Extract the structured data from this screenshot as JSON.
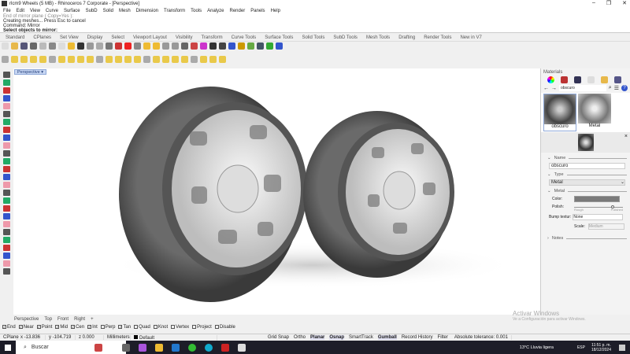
{
  "title": "rlcm9 Wheels (5 MB) - Rhinoceros 7 Corporate - [Perspective]",
  "window_buttons": [
    "–",
    "❐",
    "✕"
  ],
  "menu": [
    "File",
    "Edit",
    "View",
    "Curve",
    "Surface",
    "SubD",
    "Solid",
    "Mesh",
    "Dimension",
    "Transform",
    "Tools",
    "Analyze",
    "Render",
    "Panels",
    "Help"
  ],
  "command_history": [
    "End of mirror plane ( Copy=Yes ):",
    "Creating meshes... Press Esc to cancel",
    "Command: Mirror"
  ],
  "command_prompt": "Select objects to mirror:",
  "toolbar_tabs": [
    "Standard",
    "CPlanes",
    "Set View",
    "Display",
    "Select",
    "Viewport Layout",
    "Visibility",
    "Transform",
    "Curve Tools",
    "Surface Tools",
    "Solid Tools",
    "SubD Tools",
    "Mesh Tools",
    "Drafting",
    "Render Tools",
    "New in V7"
  ],
  "viewport_label": "Perspective ▾",
  "viewport_tabs": [
    "Perspective",
    "Top",
    "Front",
    "Right",
    "+"
  ],
  "materials": {
    "title": "Materials",
    "search": "obscuro",
    "thumbs": [
      "obscuro",
      "Metal"
    ],
    "name_section": "Name",
    "name_value": "obscuro",
    "type_section": "Type",
    "type_value": "Metal",
    "metal_section": "Metal",
    "color_label": "Color:",
    "color": "#7a7a7a",
    "polish_label": "Polish:",
    "polish_min": "Rough",
    "polish_max": "Polished",
    "polish_value": 0.8,
    "bump_label": "Bump textur:",
    "bump_value": "None",
    "scale_label": "Scale:",
    "scale_value": "Medium",
    "notes_section": "Notes"
  },
  "osnaps": [
    {
      "label": "End",
      "on": true
    },
    {
      "label": "Near",
      "on": true
    },
    {
      "label": "Point",
      "on": true
    },
    {
      "label": "Mid",
      "on": true
    },
    {
      "label": "Cen",
      "on": true
    },
    {
      "label": "Int",
      "on": true
    },
    {
      "label": "Perp",
      "on": false
    },
    {
      "label": "Tan",
      "on": true
    },
    {
      "label": "Quad",
      "on": false
    },
    {
      "label": "Knot",
      "on": false
    },
    {
      "label": "Vertex",
      "on": false
    },
    {
      "label": "Project",
      "on": false
    },
    {
      "label": "Disable",
      "on": false
    }
  ],
  "status": {
    "cplane": "CPlane",
    "x": "x -13.836",
    "y": "y -104.719",
    "z": "z 0.000",
    "units": "Millimeters",
    "layer": "Default",
    "toggles": [
      "Grid Snap",
      "Ortho",
      "Planar",
      "Osnap",
      "SmartTrack",
      "Gumball",
      "Record History",
      "Filter"
    ],
    "tolerance": "Absolute tolerance: 0.001"
  },
  "watermark": {
    "title": "Activar Windows",
    "sub": "Ve a Configuración para activar Windows."
  },
  "taskbar": {
    "search": "Buscar",
    "weather": "13°C  Lluvia ligera",
    "lang": "ESP",
    "time": "11:51 p. m.",
    "date": "18/12/2024"
  }
}
